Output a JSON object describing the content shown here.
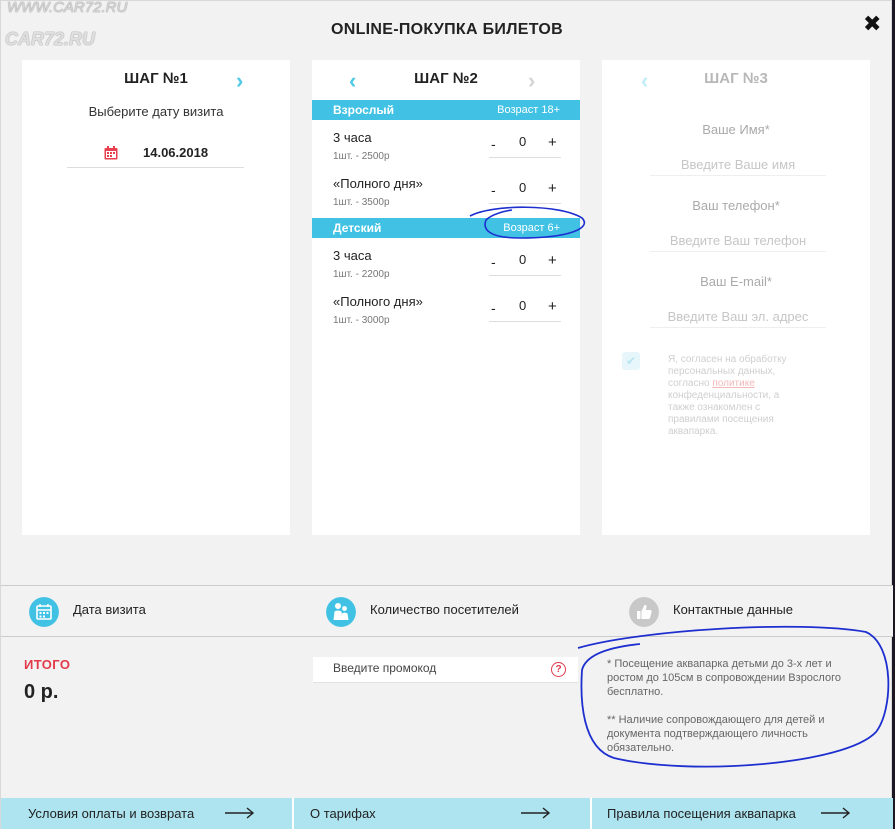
{
  "watermark": {
    "url_small": "WWW.CAR72.RU",
    "url_large": "CAR72.RU"
  },
  "modal": {
    "title": "ONLINE-ПОКУПКА БИЛЕТОВ",
    "close_symbol": "✖"
  },
  "step1": {
    "title": "ШАГ №1",
    "next_arrow": "›",
    "subtitle": "Выберите дату визита",
    "date": "14.06.2018",
    "icon": "calendar-icon"
  },
  "step2": {
    "title": "ШАГ №2",
    "prev_arrow": "‹",
    "next_arrow": "›",
    "groups": [
      {
        "label": "Взрослый",
        "age": "Возраст 18+",
        "tickets": [
          {
            "name": "3 часа",
            "price": "1шт. - 2500р",
            "qty": "0"
          },
          {
            "name": "«Полного дня»",
            "price": "1шт. - 3500р",
            "qty": "0"
          }
        ]
      },
      {
        "label": "Детский",
        "age": "Возраст 6+",
        "tickets": [
          {
            "name": "3 часа",
            "price": "1шт. - 2200р",
            "qty": "0"
          },
          {
            "name": "«Полного дня»",
            "price": "1шт. - 3000р",
            "qty": "0"
          }
        ]
      }
    ],
    "minus": "-",
    "plus": "+"
  },
  "step3": {
    "title": "ШАГ №3",
    "prev_arrow": "‹",
    "name_label": "Ваше Имя*",
    "name_placeholder": "Введите Ваше имя",
    "phone_label": "Ваш телефон*",
    "phone_placeholder": "Введите Ваш телефон",
    "email_label": "Ваш E-mail*",
    "email_placeholder": "Введите Ваш эл. адрес",
    "consent_before": "Я, согласен на обработку персональных данных, согласно ",
    "consent_link": "политике",
    "consent_after": " конфеденциальности, а также ознакомлен с правилами посещения аквапарка.",
    "check_symbol": "✔"
  },
  "steps_bar": {
    "items": [
      {
        "label": "Дата визита",
        "icon": "calendar-icon",
        "color": "#41c2e4"
      },
      {
        "label": "Количество посетителей",
        "icon": "people-icon",
        "color": "#41c2e4"
      },
      {
        "label": "Контактные данные",
        "icon": "thumbs-up-icon",
        "color": "#c8c8c8"
      }
    ]
  },
  "total": {
    "label": "ИТОГО",
    "value": "0 р."
  },
  "promo": {
    "placeholder": "Введите промокод",
    "help_symbol": "?"
  },
  "notes": [
    "* Посещение аквапарка детьми до 3-х лет и ростом до 105см в сопровождении Взрослого бесплатно.",
    "** Наличие сопровождающего для детей и документа подтверждающего личность обязательно."
  ],
  "footer": {
    "buttons": [
      {
        "label": "Условия оплаты и возврата"
      },
      {
        "label": "О тарифах"
      },
      {
        "label": "Правила посещения аквапарка"
      }
    ]
  },
  "colors": {
    "accent": "#41c2e4",
    "accent_light": "#aee4f0",
    "total_red": "#e33a4a",
    "annotation_blue": "#1e2fd0"
  }
}
